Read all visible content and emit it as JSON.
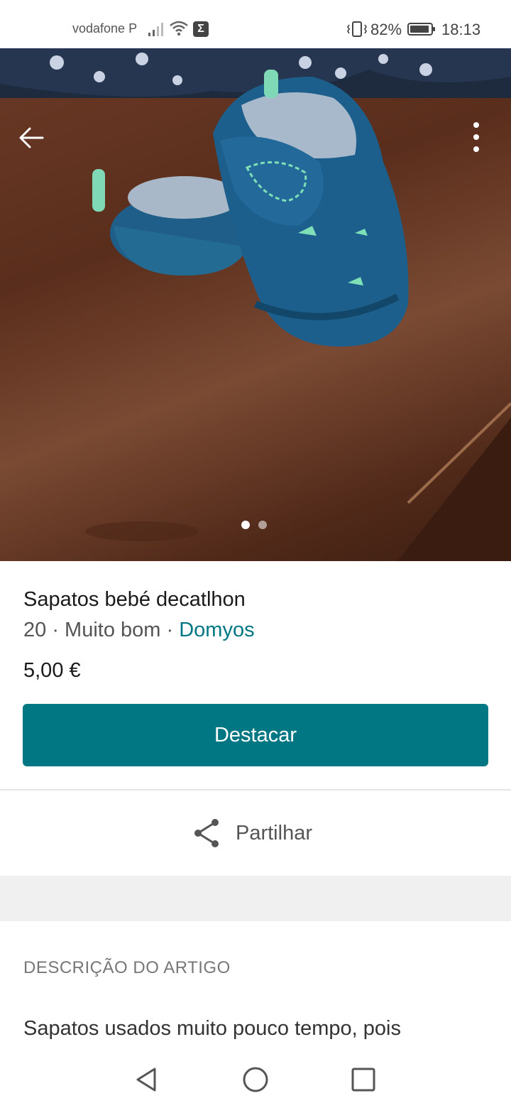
{
  "status_bar": {
    "carrier": "vodafone P",
    "sigma_badge": "Σ",
    "battery_percent": "82%",
    "time": "18:13",
    "icons": [
      "signal-icon",
      "wifi-icon",
      "sigma-icon",
      "vibrate-icon",
      "battery-icon"
    ]
  },
  "photo": {
    "icons": [
      "back-arrow-icon",
      "more-vertical-icon"
    ],
    "carousel": {
      "current": 1,
      "total": 2
    }
  },
  "item": {
    "title": "Sapatos bebé decatlhon",
    "size": "20",
    "separator": " · ",
    "condition": "Muito bom",
    "brand": "Domyos",
    "price": "5,00 €",
    "brand_color": "#007782"
  },
  "actions": {
    "feature_label": "Destacar",
    "share_label": "Partilhar"
  },
  "description": {
    "heading": "DESCRIÇÃO DO ARTIGO",
    "text": "Sapatos usados muito pouco tempo, pois"
  },
  "nav_bar": {
    "icons": [
      "nav-back-icon",
      "nav-home-icon",
      "nav-recents-icon"
    ]
  }
}
